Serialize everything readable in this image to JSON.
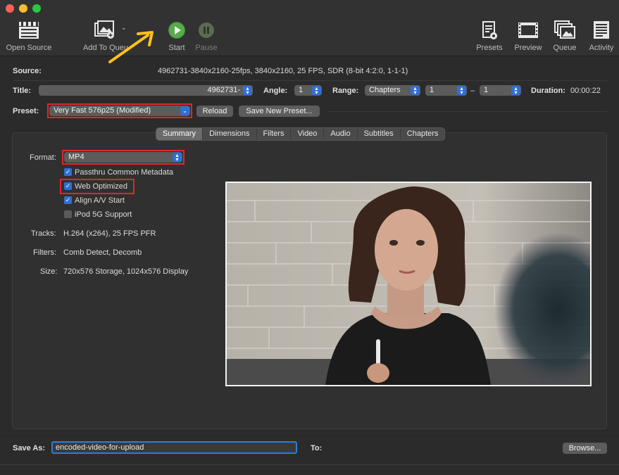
{
  "toolbar": {
    "open_source": "Open Source",
    "add_to_queue": "Add To Queue",
    "start": "Start",
    "pause": "Pause",
    "presets": "Presets",
    "preview": "Preview",
    "queue": "Queue",
    "activity": "Activity"
  },
  "source": {
    "label": "Source:",
    "value": "4962731-3840x2160-25fps, 3840x2160, 25 FPS, SDR (8-bit 4:2:0, 1-1-1)"
  },
  "title_row": {
    "title_label": "Title:",
    "title_value": "4962731-",
    "angle_label": "Angle:",
    "angle_value": "1",
    "range_label": "Range:",
    "range_mode": "Chapters",
    "range_start": "1",
    "range_dash": "–",
    "range_end": "1",
    "duration_label": "Duration:",
    "duration_value": "00:00:22"
  },
  "preset": {
    "label": "Preset:",
    "value": "Very Fast 576p25 (Modified)",
    "reload": "Reload",
    "save_new": "Save New Preset..."
  },
  "tabs": [
    "Summary",
    "Dimensions",
    "Filters",
    "Video",
    "Audio",
    "Subtitles",
    "Chapters"
  ],
  "summary": {
    "format_label": "Format:",
    "format_value": "MP4",
    "options": [
      {
        "label": "Passthru Common Metadata",
        "checked": true
      },
      {
        "label": "Web Optimized",
        "checked": true
      },
      {
        "label": "Align A/V Start",
        "checked": true
      },
      {
        "label": "iPod 5G Support",
        "checked": false
      }
    ],
    "tracks_label": "Tracks:",
    "tracks_value": "H.264 (x264), 25 FPS PFR",
    "filters_label": "Filters:",
    "filters_value": "Comb Detect, Decomb",
    "size_label": "Size:",
    "size_value": "720x576 Storage, 1024x576 Display"
  },
  "save": {
    "label": "Save As:",
    "value": "encoded-video-for-upload",
    "to_label": "To:",
    "browse": "Browse..."
  },
  "colors": {
    "accent": "#2f6fd6",
    "highlight": "#e0262d",
    "annotation_arrow": "#ffc21a"
  }
}
